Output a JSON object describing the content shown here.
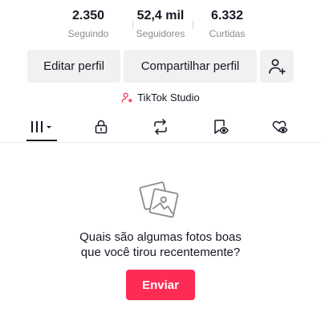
{
  "stats": [
    {
      "value": "2.350",
      "label": "Seguindo"
    },
    {
      "value": "52,4 mil",
      "label": "Seguidores"
    },
    {
      "value": "6.332",
      "label": "Curtidas"
    }
  ],
  "actions": {
    "edit_label": "Editar perfil",
    "share_label": "Compartilhar perfil",
    "add_friend_icon": "add-person-icon"
  },
  "studio": {
    "label": "TikTok Studio",
    "icon": "person-star-icon"
  },
  "tabs": [
    {
      "name": "videos",
      "icon": "grid-columns-icon",
      "active": true
    },
    {
      "name": "private",
      "icon": "lock-icon",
      "active": false
    },
    {
      "name": "reposts",
      "icon": "repost-icon",
      "active": false
    },
    {
      "name": "favorites",
      "icon": "bookmark-eye-icon",
      "active": false
    },
    {
      "name": "liked",
      "icon": "heart-eye-icon",
      "active": false
    }
  ],
  "empty_state": {
    "icon": "photos-icon",
    "line1": "Quais são algumas fotos boas",
    "line2": "que você tirou recentemente?",
    "button_label": "Enviar"
  },
  "colors": {
    "accent": "#fe2c55",
    "button_bg": "#f1f1f2",
    "muted_text": "#8a8b91"
  }
}
